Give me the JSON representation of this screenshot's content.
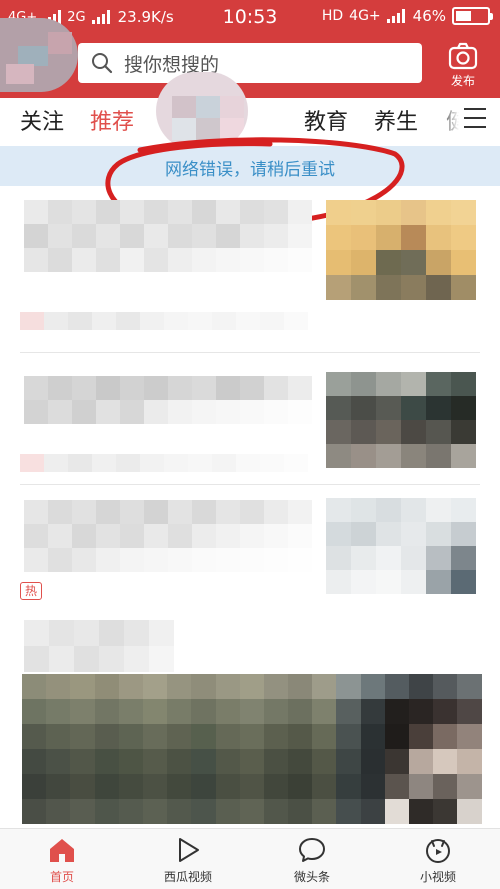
{
  "status_bar": {
    "network_1": "4G+",
    "network_2": "2G",
    "speed": "23.9K/s",
    "time": "10:53",
    "hd": "HD",
    "network_3": "4G+",
    "battery": "46%"
  },
  "header": {
    "search_placeholder": "搜你想搜的",
    "publish_label": "发布"
  },
  "tabs": [
    {
      "label": "关注"
    },
    {
      "label": "推荐"
    },
    {
      "label": "热点"
    },
    {
      "label": "教育"
    },
    {
      "label": "养生"
    },
    {
      "label": "健"
    }
  ],
  "error_banner": {
    "text": "网络错误，请稍后重试"
  },
  "feed": {
    "hot_badge": "热"
  },
  "bottom_nav": [
    {
      "label": "首页"
    },
    {
      "label": "西瓜视频"
    },
    {
      "label": "微头条"
    },
    {
      "label": "小视频"
    }
  ],
  "colors": {
    "brand_red": "#d43d3d",
    "active_red": "#e0504c",
    "banner_bg": "#ddeaf6",
    "banner_text": "#3a8fc7"
  }
}
